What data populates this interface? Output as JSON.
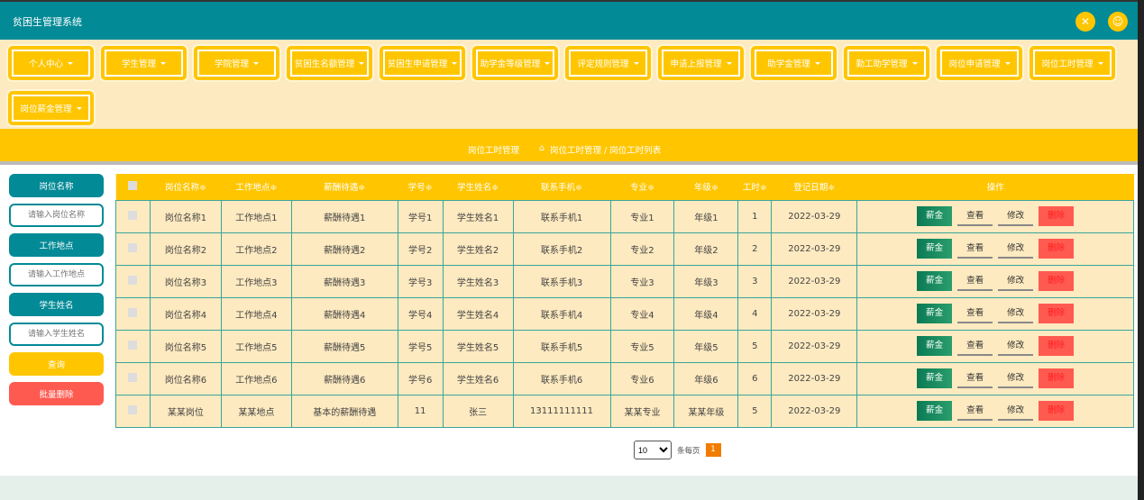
{
  "header": {
    "title": "贫困生管理系统",
    "icons": [
      "fullscreen-icon",
      "user-icon"
    ]
  },
  "nav": [
    "个人中心",
    "学生管理",
    "学院管理",
    "贫困生名额管理",
    "贫困生申请管理",
    "助学金等级管理",
    "评定规则管理",
    "申请上报管理",
    "助学金管理",
    "勤工助学管理",
    "岗位申请管理",
    "岗位工时管理",
    "岗位薪金管理"
  ],
  "breadcrumb": {
    "current": "岗位工时管理",
    "path": "岗位工时管理 / 岗位工时列表"
  },
  "search": {
    "f1_label": "岗位名称",
    "f1_placeholder": "请输入岗位名称",
    "f2_label": "工作地点",
    "f2_placeholder": "请输入工作地点",
    "f3_label": "学生姓名",
    "f3_placeholder": "请输入学生姓名",
    "query": "查询",
    "batch_delete": "批量删除"
  },
  "table": {
    "headers": [
      "岗位名称≑",
      "工作地点≑",
      "薪酬待遇≑",
      "学号≑",
      "学生姓名≑",
      "联系手机≑",
      "专业≑",
      "年级≑",
      "工时≑",
      "登记日期≑",
      "操作"
    ],
    "rows": [
      [
        "岗位名称1",
        "工作地点1",
        "薪酬待遇1",
        "学号1",
        "学生姓名1",
        "联系手机1",
        "专业1",
        "年级1",
        "1",
        "2022-03-29"
      ],
      [
        "岗位名称2",
        "工作地点2",
        "薪酬待遇2",
        "学号2",
        "学生姓名2",
        "联系手机2",
        "专业2",
        "年级2",
        "2",
        "2022-03-29"
      ],
      [
        "岗位名称3",
        "工作地点3",
        "薪酬待遇3",
        "学号3",
        "学生姓名3",
        "联系手机3",
        "专业3",
        "年级3",
        "3",
        "2022-03-29"
      ],
      [
        "岗位名称4",
        "工作地点4",
        "薪酬待遇4",
        "学号4",
        "学生姓名4",
        "联系手机4",
        "专业4",
        "年级4",
        "4",
        "2022-03-29"
      ],
      [
        "岗位名称5",
        "工作地点5",
        "薪酬待遇5",
        "学号5",
        "学生姓名5",
        "联系手机5",
        "专业5",
        "年级5",
        "5",
        "2022-03-29"
      ],
      [
        "岗位名称6",
        "工作地点6",
        "薪酬待遇6",
        "学号6",
        "学生姓名6",
        "联系手机6",
        "专业6",
        "年级6",
        "6",
        "2022-03-29"
      ],
      [
        "某某岗位",
        "某某地点",
        "基本的薪酬待遇",
        "11",
        "张三",
        "13111111111",
        "某某专业",
        "某某年级",
        "5",
        "2022-03-29"
      ]
    ],
    "actions": [
      "薪金",
      "查看",
      "修改",
      "删除"
    ]
  },
  "pager": {
    "page_size": "10",
    "per_page_label": "条每页",
    "current_page": "1"
  },
  "colors": {
    "primary": "#028a96",
    "accent": "#ffc600",
    "danger": "#ff5a50"
  }
}
